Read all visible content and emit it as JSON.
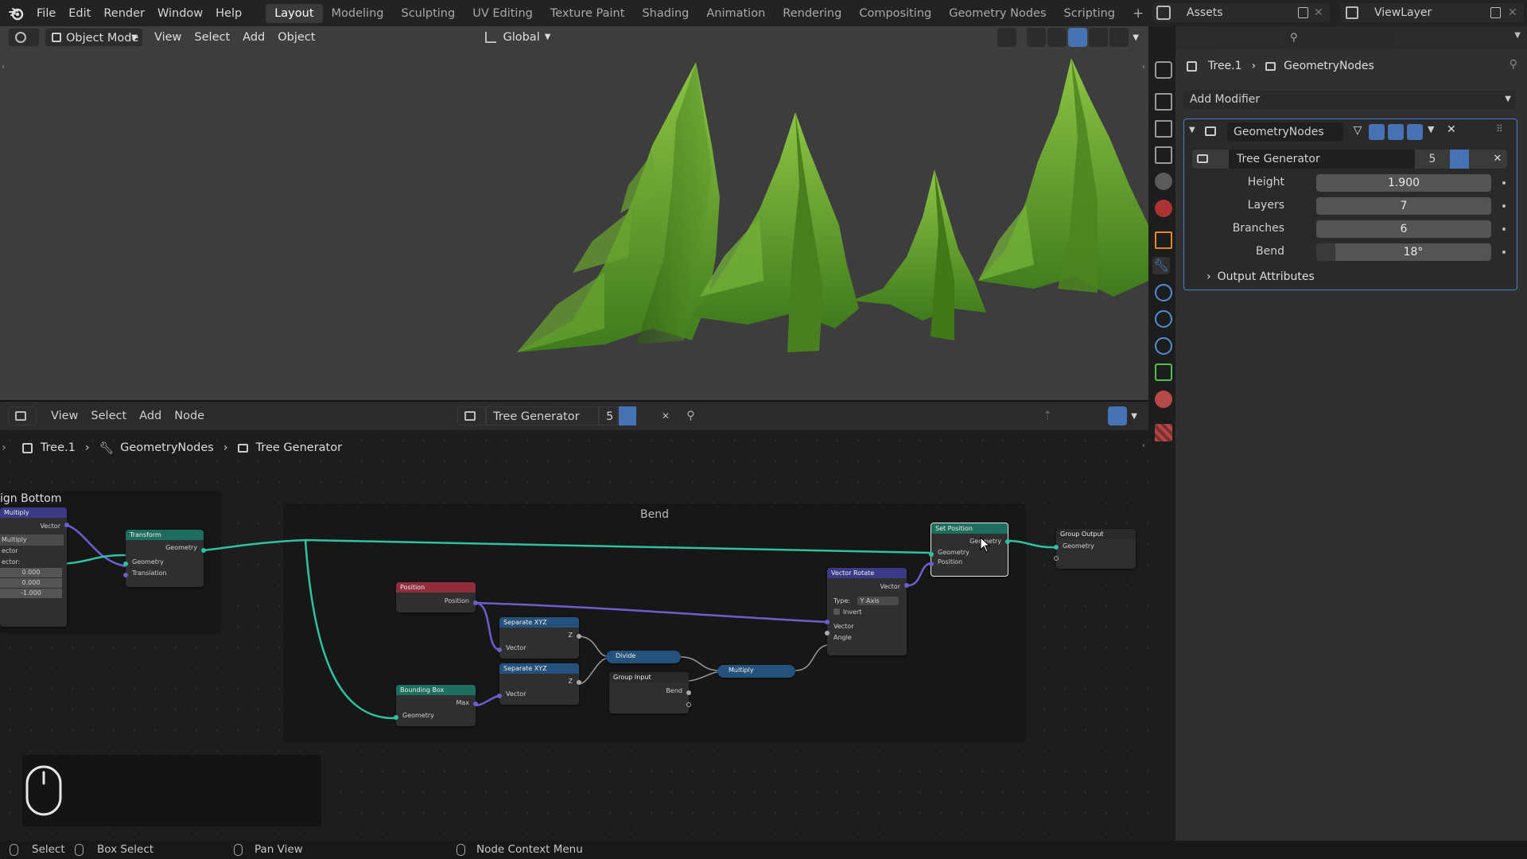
{
  "menu": {
    "items": [
      "File",
      "Edit",
      "Render",
      "Window",
      "Help"
    ],
    "workspaces": [
      "Layout",
      "Modeling",
      "Sculpting",
      "UV Editing",
      "Texture Paint",
      "Shading",
      "Animation",
      "Rendering",
      "Compositing",
      "Geometry Nodes",
      "Scripting"
    ],
    "active_workspace": "Layout",
    "add_tab": "+"
  },
  "topright": {
    "assets_label": "Assets",
    "viewlayer_label": "ViewLayer"
  },
  "viewport": {
    "mode": "Object Mode",
    "menus": [
      "View",
      "Select",
      "Add",
      "Object"
    ],
    "transform_orientation": "Global"
  },
  "node_editor": {
    "menus": [
      "View",
      "Select",
      "Add",
      "Node"
    ],
    "tree_name": "Tree Generator",
    "user_count": "5",
    "breadcrumb": [
      "Tree.1",
      "GeometryNodes",
      "Tree Generator"
    ],
    "frames": {
      "left_frame_title": "ign Bottom",
      "bend_frame_title": "Bend"
    },
    "nodes": {
      "multiply_header": "Multiply",
      "multiply_vector": "Vector",
      "multiply_op": "Multiply",
      "multiply_vec_label": "ector",
      "multiply_vec2_label": "ector:",
      "multiply_vals": [
        "0.000",
        "0.000",
        "-1.000"
      ],
      "transform_header": "Transform",
      "transform_geo_out": "Geometry",
      "transform_geo_in": "Geometry",
      "transform_translation": "Translation",
      "position_header": "Position",
      "position_out": "Position",
      "sep1_header": "Separate XYZ",
      "sep1_z": "Z",
      "sep1_vec": "Vector",
      "sep2_header": "Separate XYZ",
      "sep2_z": "Z",
      "sep2_vec": "Vector",
      "bbox_header": "Bounding Box",
      "bbox_max": "Max",
      "bbox_geo": "Geometry",
      "divide_header": "Divide",
      "groupinput_header": "Group Input",
      "groupinput_bend": "Bend",
      "multiply2_header": "Multiply",
      "vrot_header": "Vector Rotate",
      "vrot_vector_out": "Vector",
      "vrot_type_label": "Type:",
      "vrot_type_value": "Y Axis",
      "vrot_invert": "Invert",
      "vrot_vector_in": "Vector",
      "vrot_angle": "Angle",
      "setpos_header": "Set Position",
      "setpos_geo_out": "Geometry",
      "setpos_geo_in": "Geometry",
      "setpos_pos": "Position",
      "groupoutput_header": "Group Output",
      "groupoutput_geo": "Geometry"
    }
  },
  "properties": {
    "breadcrumb_object": "Tree.1",
    "breadcrumb_modifier": "GeometryNodes",
    "add_modifier": "Add Modifier",
    "modifier_name": "GeometryNodes",
    "node_group_name": "Tree Generator",
    "node_group_users": "5",
    "inputs": [
      {
        "label": "Height",
        "value": "1.900"
      },
      {
        "label": "Layers",
        "value": "7"
      },
      {
        "label": "Branches",
        "value": "6"
      },
      {
        "label": "Bend",
        "value": "18°"
      }
    ],
    "output_attributes": "Output Attributes"
  },
  "statusbar": {
    "items": [
      "Select",
      "Box Select",
      "Pan View",
      "Node Context Menu"
    ]
  },
  "colors": {
    "geometry_wire": "#2ec2a3",
    "vector_wire": "#6b5fcf",
    "node_geometry_header": "#1e6e5f",
    "node_input_header": "#8f2d3d",
    "node_converter_header": "#24527d",
    "node_vector_header": "#3b3a86",
    "tree_green": "#4f8a24"
  }
}
